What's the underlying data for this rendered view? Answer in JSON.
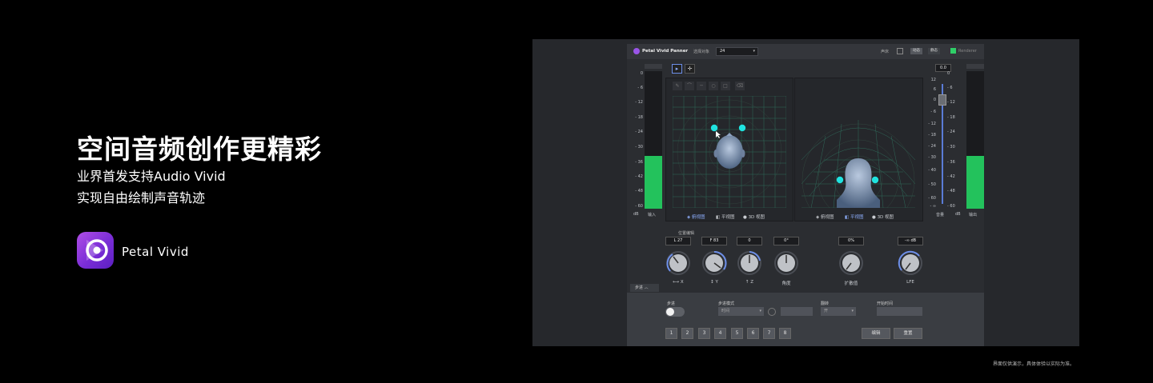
{
  "promo": {
    "title": "空间音频创作更精彩",
    "subtitle1": "业界首发支持Audio Vivid",
    "subtitle2": "实现自由绘制声音轨迹",
    "app_name": "Petal Vivid",
    "disclaimer": "界面仅供演示，具体体验以实际为准。"
  },
  "plugin": {
    "title": "Petal Vivid Panner",
    "select_label": "选择对象",
    "select_value": "24",
    "right_label": "声床",
    "btn1": "动态",
    "btn2": "静态",
    "right_label2": "Renderer",
    "input_meter_label": "输入",
    "output_meter_label": "输出",
    "db_label": "dB",
    "volume_label": "音量",
    "volume_value": "0.0",
    "meter_scale": [
      "0",
      "- 6",
      "- 12",
      "- 18",
      "- 24",
      "- 30",
      "- 36",
      "- 42",
      "- 48",
      "- 60"
    ],
    "volume_scale": [
      "12",
      "6",
      "0",
      "- 6",
      "- 12",
      "- 18",
      "- 24",
      "- 30",
      "- 40",
      "- 50",
      "- 60",
      "- ∞"
    ],
    "views_left": [
      "俯视图",
      "平视图",
      "3D 视图"
    ],
    "views_right": [
      "俯视图",
      "平视图",
      "3D 视图"
    ],
    "section_label": "位置编辑",
    "params": [
      {
        "value": "L 27",
        "label": "X"
      },
      {
        "value": "F 83",
        "label": "Y"
      },
      {
        "value": "0",
        "label": "Z"
      },
      {
        "value": "0°",
        "label": "角度"
      },
      {
        "value": "0%",
        "label": "扩散值"
      },
      {
        "value": "-∞ dB",
        "label": "LFE"
      }
    ],
    "tab_label": "步进",
    "bottom": {
      "step_label": "步进",
      "mode_label": "步进模式",
      "mode_value": "时间",
      "flip_label": "翻转",
      "flip_value": "开",
      "start_label": "开始时间",
      "numbers": [
        "1",
        "2",
        "3",
        "4",
        "5",
        "6",
        "7",
        "8"
      ],
      "edit_button": "编辑",
      "reset_button": "重置"
    }
  },
  "colors": {
    "accent": "#8fb0ff",
    "meter_green": "#23c25c",
    "object_dot": "#1fe3e0",
    "app_purple": "#8a3be0"
  }
}
